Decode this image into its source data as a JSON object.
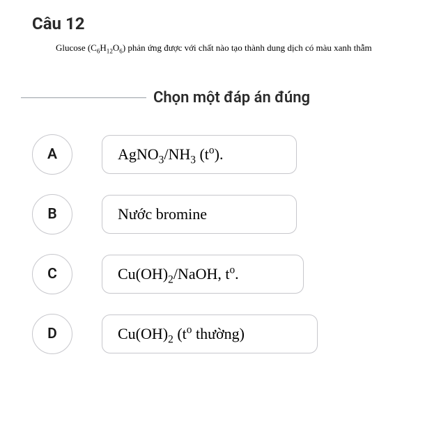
{
  "question": {
    "number": "Câu 12",
    "text_parts": {
      "p1": "Glucose (C",
      "s1": "6",
      "p2": "H",
      "s2": "12",
      "p3": "O",
      "s3": "6",
      "p4": ") phản ứng được với chất nào tạo thành dung dịch có màu xanh thẫm"
    }
  },
  "instruction": "Chọn một đáp án đúng",
  "options": {
    "A": {
      "letter": "A",
      "parts": {
        "p1": "AgNO",
        "s1": "3",
        "p2": "/NH",
        "s2": "3",
        "p3": " (t",
        "sup1": "o",
        "p4": ")."
      }
    },
    "B": {
      "letter": "B",
      "text": "Nước bromine"
    },
    "C": {
      "letter": "C",
      "parts": {
        "p1": "Cu(OH)",
        "s1": "2",
        "p2": "/NaOH, t",
        "sup1": "o",
        "p3": "."
      }
    },
    "D": {
      "letter": "D",
      "parts": {
        "p1": "Cu(OH)",
        "s1": "2",
        "p2": " (t",
        "sup1": "o",
        "p3": " thường)"
      }
    }
  }
}
